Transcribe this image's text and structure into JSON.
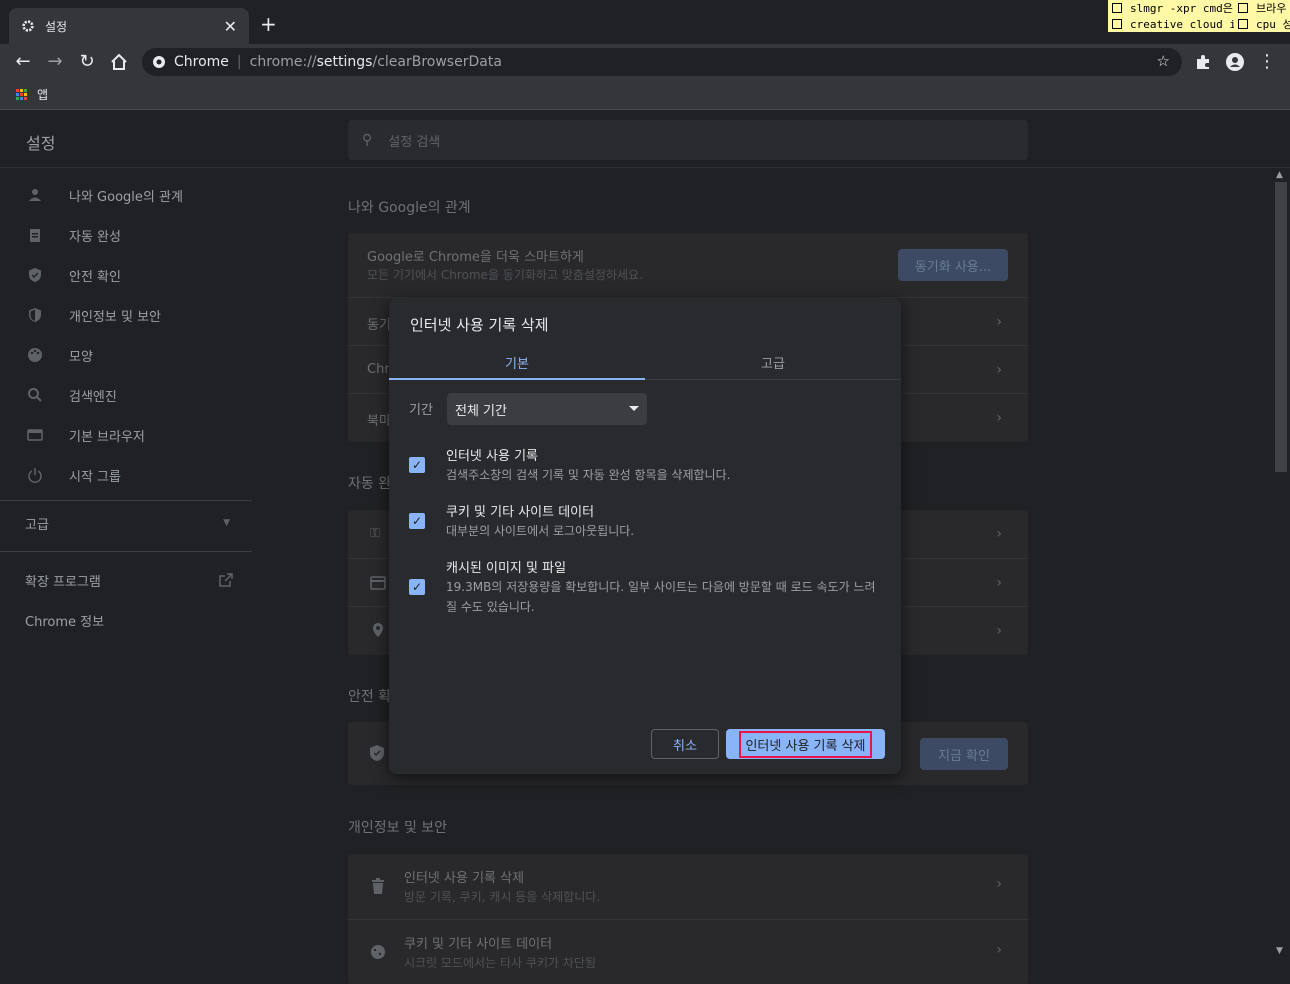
{
  "tab": {
    "title": "설정",
    "close": "✕",
    "new_tab": "+"
  },
  "sticky": {
    "items": [
      "slmgr -xpr cmd은",
      "브라우",
      "creative cloud i",
      "cpu 성"
    ]
  },
  "omnibox": {
    "site": "Chrome",
    "url_prefix": "chrome://",
    "url_host": "settings",
    "url_path": "/clearBrowserData"
  },
  "bookmarks": {
    "apps_label": "앱"
  },
  "header": {
    "title": "설정",
    "search_placeholder": "설정 검색"
  },
  "sidebar": {
    "items": [
      {
        "label": "나와 Google의 관계",
        "icon": "person-icon"
      },
      {
        "label": "자동 완성",
        "icon": "clipboard-icon"
      },
      {
        "label": "안전 확인",
        "icon": "shield-check-icon"
      },
      {
        "label": "개인정보 및 보안",
        "icon": "shield-icon"
      },
      {
        "label": "모양",
        "icon": "palette-icon"
      },
      {
        "label": "검색엔진",
        "icon": "search-icon"
      },
      {
        "label": "기본 브라우저",
        "icon": "browser-icon"
      },
      {
        "label": "시작 그룹",
        "icon": "power-icon"
      }
    ],
    "advanced": "고급",
    "extensions": "확장 프로그램",
    "about": "Chrome 정보"
  },
  "main": {
    "section_you": "나와 Google의 관계",
    "sync_title": "Google로 Chrome을 더욱 스마트하게",
    "sync_sub": "모든 기기에서 Chrome을 동기화하고 맞춤설정하세요.",
    "sync_button": "동기화 사용...",
    "row_sync": "동기",
    "row_chrome": "Chr",
    "row_import": "북마",
    "section_autofill": "자동 완",
    "section_safety": "안전 확",
    "safety_button": "지금 확인",
    "section_privacy": "개인정보 및 보안",
    "clear_title": "인터넷 사용 기록 삭제",
    "clear_sub": "방문 기록, 쿠키, 캐시 등을 삭제합니다.",
    "cookies_title": "쿠키 및 기타 사이트 데이터",
    "cookies_sub": "시크릿 모드에서는 타사 쿠키가 차단됨"
  },
  "dialog": {
    "title": "인터넷 사용 기록 삭제",
    "tabs": [
      "기본",
      "고급"
    ],
    "period_label": "기간",
    "period_value": "전체 기간",
    "options": [
      {
        "title": "인터넷 사용 기록",
        "desc": "검색주소창의 검색 기록 및 자동 완성 항목을 삭제합니다.",
        "checked": true
      },
      {
        "title": "쿠키 및 기타 사이트 데이터",
        "desc": "대부분의 사이트에서 로그아웃됩니다.",
        "checked": true
      },
      {
        "title": "캐시된 이미지 및 파일",
        "desc": "19.3MB의 저장용량을 확보합니다. 일부 사이트는 다음에 방문할 때 로드 속도가 느려질 수도 있습니다.",
        "checked": true
      }
    ],
    "cancel": "취소",
    "confirm": "인터넷 사용 기록 삭제"
  },
  "colors": {
    "accent": "#8ab4f8",
    "highlight_border": "#e8154a"
  }
}
